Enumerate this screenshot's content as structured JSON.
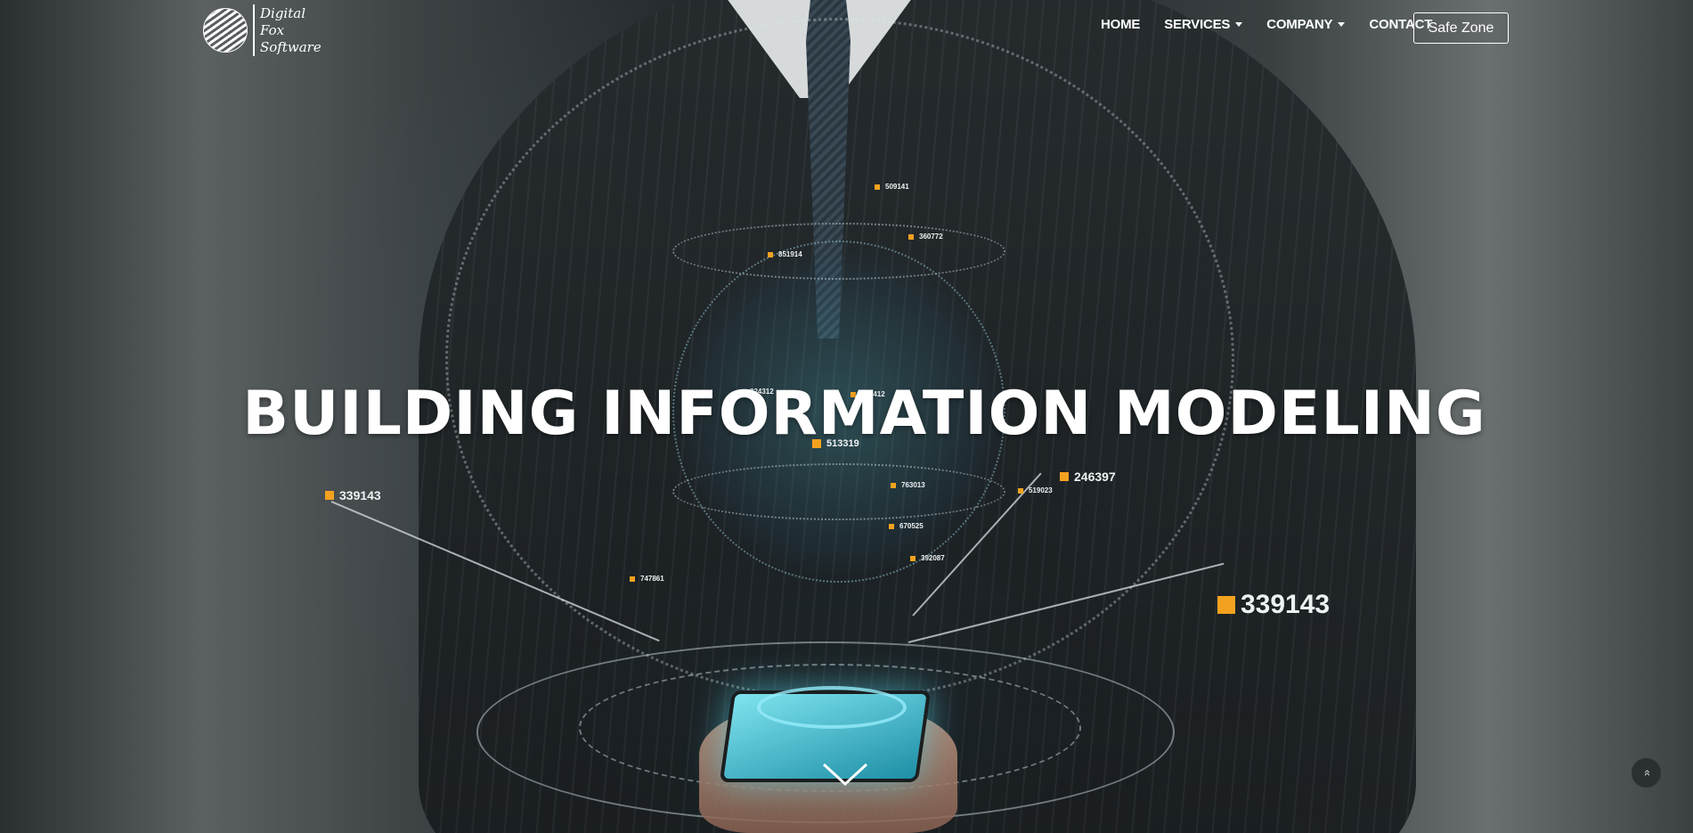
{
  "brand": {
    "name_line1": "Digital",
    "name_line2": "Fox",
    "name_line3": "Software",
    "logo_icon": "striped-globe-logo"
  },
  "nav": {
    "items": [
      {
        "label": "HOME",
        "has_dropdown": false
      },
      {
        "label": "SERVICES",
        "has_dropdown": true
      },
      {
        "label": "COMPANY",
        "has_dropdown": true
      },
      {
        "label": "CONTACT",
        "has_dropdown": false
      }
    ],
    "cta_label": "Safe Zone"
  },
  "hero": {
    "headline": "BUILDING INFORMATION MODELING",
    "data_tags": {
      "left": "339143",
      "right_upper": "246397",
      "right_big": "339143",
      "t1": "509141",
      "t2": "360772",
      "t3": "851914",
      "t4": "824312",
      "t5": "705412",
      "t6": "513319",
      "t7": "763013",
      "t8": "519023",
      "t9": "670525",
      "t10": "392087",
      "t11": "747861"
    },
    "scroll_icon": "chevron-down-icon"
  },
  "back_to_top": {
    "icon": "double-chevron-up-icon",
    "glyph": "»"
  },
  "colors": {
    "accent_tag": "#f3a21f",
    "hologram": "#5cd6e8",
    "text": "#ffffff"
  }
}
